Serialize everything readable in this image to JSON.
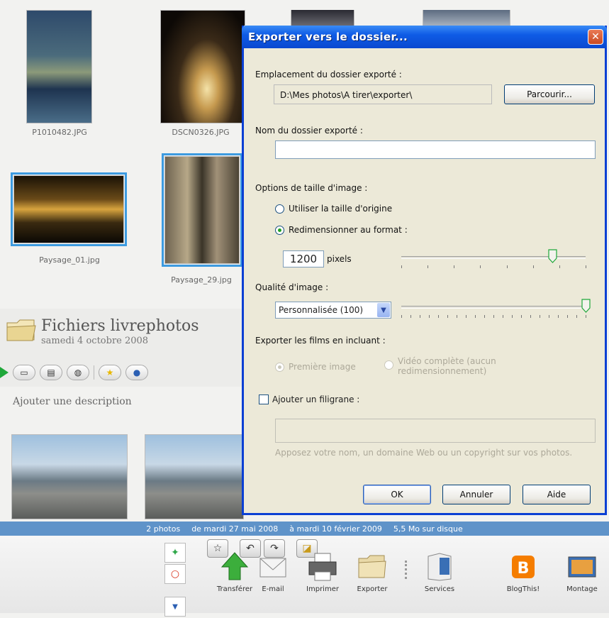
{
  "library": {
    "thumbnails": [
      {
        "name": "P1010482.JPG"
      },
      {
        "name": "DSCN0326.JPG"
      },
      {
        "name": "Paysage_01.jpg"
      },
      {
        "name": "Paysage_29.jpg"
      }
    ],
    "album": {
      "title": "Fichiers livrephotos",
      "date": "samedi 4 octobre 2008",
      "add_description": "Ajouter une description"
    }
  },
  "status_bar": {
    "count": "2 photos",
    "from": "de mardi 27 mai 2008",
    "to": "à mardi 10 février 2009",
    "size": "5,5 Mo sur disque"
  },
  "tray": {
    "tools": [
      {
        "label": "Transférer",
        "icon": "upload-arrow-icon"
      },
      {
        "label": "E-mail",
        "icon": "envelope-icon"
      },
      {
        "label": "Imprimer",
        "icon": "printer-icon"
      },
      {
        "label": "Exporter",
        "icon": "folder-icon"
      },
      {
        "label": "Services",
        "icon": "book-icon"
      },
      {
        "label": "BlogThis!",
        "icon": "blogger-icon"
      },
      {
        "label": "Montage",
        "icon": "picture-icon"
      }
    ]
  },
  "dialog": {
    "title": "Exporter vers le dossier...",
    "location_label": "Emplacement du dossier exporté :",
    "location_value": "D:\\Mes photos\\A tirer\\exporter\\",
    "browse_label": "Parcourir...",
    "folder_name_label": "Nom du dossier exporté :",
    "folder_name_value": "",
    "size_options_label": "Options de taille d'image :",
    "size_original_label": "Utiliser la taille d'origine",
    "size_resize_label": "Redimensionner au format :",
    "size_selected": "resize",
    "pixels_value": "1200",
    "pixels_unit": "pixels",
    "pixels_slider_fraction": 0.82,
    "quality_label": "Qualité d'image :",
    "quality_value": "Personnalisée (100)",
    "quality_slider_fraction": 1.0,
    "movies_label": "Exporter les films en incluant :",
    "movies_first_label": "Première image",
    "movies_full_label": "Vidéo complète (aucun redimensionnement)",
    "movies_selected": "first",
    "watermark_label": "Ajouter un filigrane :",
    "watermark_checked": false,
    "watermark_value": "",
    "watermark_hint": "Apposez votre nom, un domaine Web ou un copyright sur vos photos.",
    "ok_label": "OK",
    "cancel_label": "Annuler",
    "help_label": "Aide"
  }
}
